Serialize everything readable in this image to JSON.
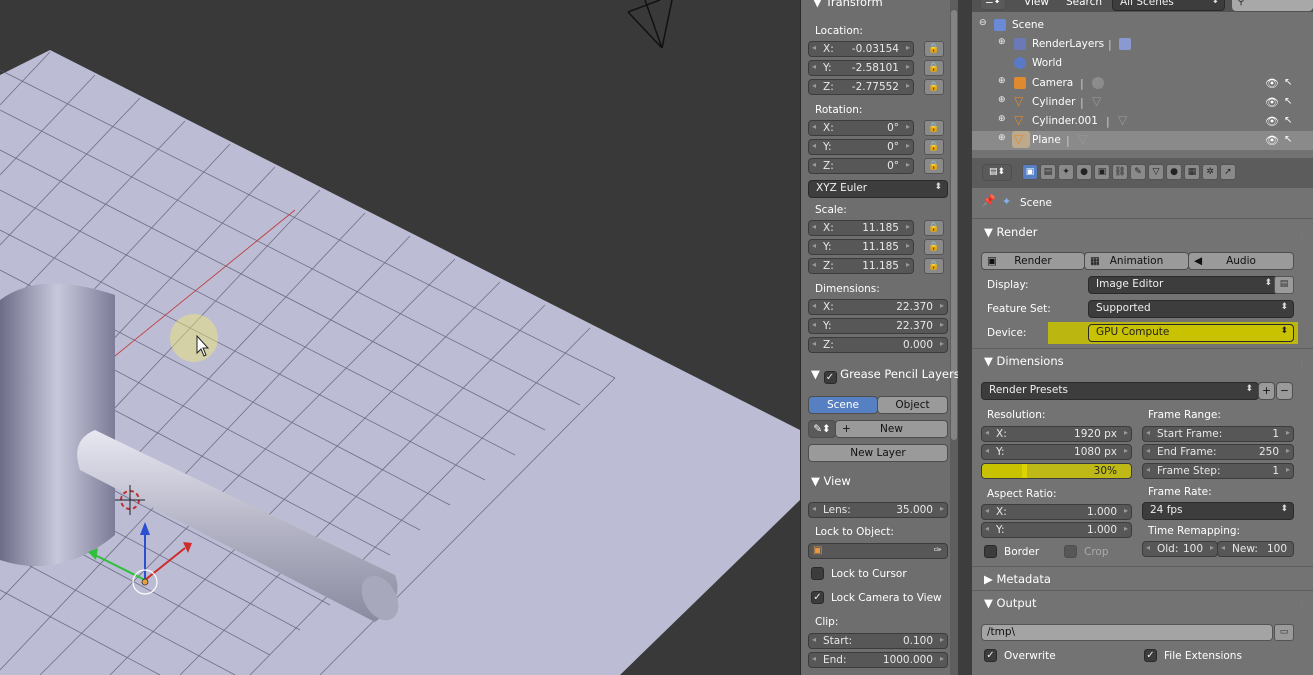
{
  "npanel": {
    "transform_header": "Transform",
    "location_label": "Location:",
    "location": {
      "x": "-0.03154",
      "y": "-2.58101",
      "z": "-2.77552"
    },
    "rotation_label": "Rotation:",
    "rotation": {
      "x": "0°",
      "y": "0°",
      "z": "0°"
    },
    "rotation_mode": "XYZ Euler",
    "scale_label": "Scale:",
    "scale": {
      "x": "11.185",
      "y": "11.185",
      "z": "11.185"
    },
    "dimensions_label": "Dimensions:",
    "dimensions": {
      "x": "22.370",
      "y": "22.370",
      "z": "0.000"
    },
    "axis_x": "X:",
    "axis_y": "Y:",
    "axis_z": "Z:",
    "grease_header": "Grease Pencil Layers",
    "grease_tab_scene": "Scene",
    "grease_tab_object": "Object",
    "grease_new": "New",
    "grease_new_layer": "New Layer",
    "view_header": "View",
    "lens_label": "Lens:",
    "lens_value": "35.000",
    "lock_to_object_label": "Lock to Object:",
    "lock_to_cursor": "Lock to Cursor",
    "lock_camera_to_view": "Lock Camera to View",
    "clip_label": "Clip:",
    "clip_start_label": "Start:",
    "clip_start": "0.100",
    "clip_end_label": "End:",
    "clip_end": "1000.000"
  },
  "outliner": {
    "menu_view": "View",
    "menu_search": "Search",
    "scenes_dropdown": "All Scenes",
    "items": [
      {
        "name": "Scene",
        "icon": "scene-icon"
      },
      {
        "name": "RenderLayers",
        "icon": "renderlayers-icon"
      },
      {
        "name": "World",
        "icon": "world-icon"
      },
      {
        "name": "Camera",
        "icon": "camera-icon"
      },
      {
        "name": "Cylinder",
        "icon": "mesh-icon"
      },
      {
        "name": "Cylinder.001",
        "icon": "mesh-icon"
      },
      {
        "name": "Plane",
        "icon": "mesh-icon"
      }
    ]
  },
  "properties": {
    "context_scene": "Scene",
    "render_header": "Render",
    "render_btn": "Render",
    "animation_btn": "Animation",
    "audio_btn": "Audio",
    "display_label": "Display:",
    "display_value": "Image Editor",
    "feature_set_label": "Feature Set:",
    "feature_set_value": "Supported",
    "device_label": "Device:",
    "device_value": "GPU Compute",
    "dimensions_header": "Dimensions",
    "render_presets": "Render Presets",
    "resolution_label": "Resolution:",
    "res_x_label": "X:",
    "res_x": "1920 px",
    "res_y_label": "Y:",
    "res_y": "1080 px",
    "res_percent": "30%",
    "res_percent_value": 0.3,
    "aspect_label": "Aspect Ratio:",
    "aspect_x_label": "X:",
    "aspect_x": "1.000",
    "aspect_y_label": "Y:",
    "aspect_y": "1.000",
    "border_label": "Border",
    "crop_label": "Crop",
    "frame_range_label": "Frame Range:",
    "start_frame_label": "Start Frame:",
    "start_frame": "1",
    "end_frame_label": "End Frame:",
    "end_frame": "250",
    "frame_step_label": "Frame Step:",
    "frame_step": "1",
    "frame_rate_label": "Frame Rate:",
    "frame_rate": "24 fps",
    "time_remap_label": "Time Remapping:",
    "old_label": "Old:",
    "old_value": "100",
    "new_label": "New:",
    "new_value": "100",
    "metadata_header": "Metadata",
    "output_header": "Output",
    "output_path": "/tmp\\",
    "overwrite_label": "Overwrite",
    "file_ext_label": "File Extensions"
  },
  "colors": {
    "highlight": "#c9c200",
    "active_tab": "#5680c2",
    "viewport_bg": "#393939",
    "plane": "#bcbcd4"
  }
}
